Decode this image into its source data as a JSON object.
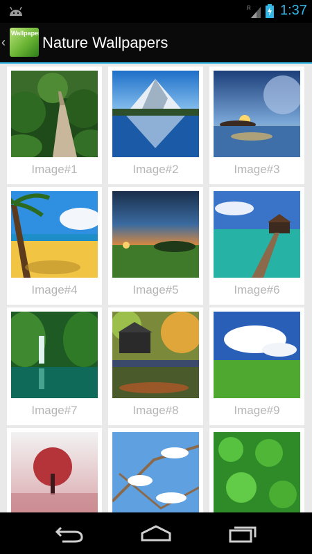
{
  "status_bar": {
    "time": "1:37",
    "roaming_indicator": "R",
    "icons": [
      "android-notification-icon",
      "signal-icon",
      "battery-charging-icon"
    ]
  },
  "action_bar": {
    "title": "Nature Wallpapers",
    "app_icon_text": "Wallpapers",
    "icons": [
      "up-chevron-icon",
      "app-icon"
    ]
  },
  "gallery": {
    "items": [
      {
        "label": "Image#1",
        "scene": "forest boardwalk"
      },
      {
        "label": "Image#2",
        "scene": "mountain lake reflection"
      },
      {
        "label": "Image#3",
        "scene": "fantasy sunset island"
      },
      {
        "label": "Image#4",
        "scene": "palm beach"
      },
      {
        "label": "Image#5",
        "scene": "sunset meadow"
      },
      {
        "label": "Image#6",
        "scene": "pier over lagoon"
      },
      {
        "label": "Image#7",
        "scene": "jungle waterfall"
      },
      {
        "label": "Image#8",
        "scene": "autumn cabin by river"
      },
      {
        "label": "Image#9",
        "scene": "green field blue sky"
      },
      {
        "label": "",
        "scene": "red tree in mist"
      },
      {
        "label": "",
        "scene": "snowy branches"
      },
      {
        "label": "",
        "scene": "clover leaves"
      }
    ]
  },
  "navigation_bar": {
    "buttons": [
      "back-icon",
      "home-icon",
      "recent-apps-icon"
    ]
  },
  "colors": {
    "accent": "#33b5e5",
    "caption": "#b5b5b5",
    "grid_background": "#e9e9e9"
  }
}
